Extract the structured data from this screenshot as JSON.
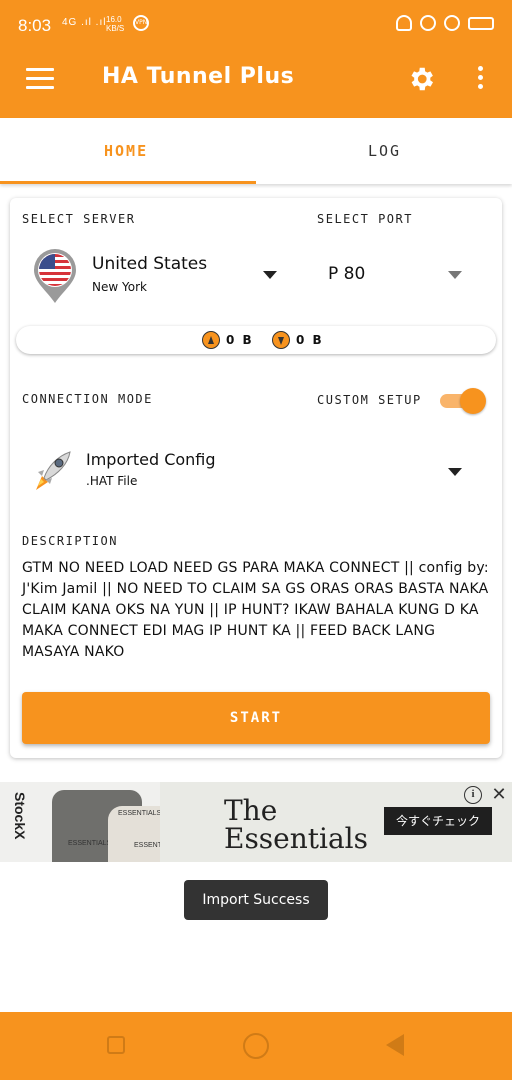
{
  "status_bar": {
    "time": "8:03",
    "signal_text": "4G .ıl .ıl",
    "speed_value": "16.0",
    "speed_unit": "KB/S",
    "vpn_label": "VPN",
    "icons": [
      "vpn-icon",
      "bell-off-icon",
      "location-icon",
      "check-icon",
      "battery-icon"
    ]
  },
  "app_bar": {
    "title": "HA Tunnel Plus",
    "icons": [
      "menu-icon",
      "gear-icon",
      "more-vert-icon"
    ]
  },
  "tabs": [
    {
      "label": "HOME",
      "active": true
    },
    {
      "label": "LOG",
      "active": false
    }
  ],
  "server": {
    "section_label": "SELECT SERVER",
    "country": "United States",
    "city": "New York",
    "flag_icon": "us-flag-pin-icon"
  },
  "port": {
    "section_label": "SELECT PORT",
    "value": "P 80"
  },
  "traffic": {
    "upload": "0 B",
    "download": "0 B"
  },
  "connection": {
    "section_label": "CONNECTION MODE",
    "custom_setup_label": "CUSTOM SETUP",
    "custom_setup_enabled": true,
    "mode_name": "Imported Config",
    "mode_file": ".HAT File",
    "mode_icon": "rocket-icon"
  },
  "description": {
    "section_label": "DESCRIPTION",
    "text": "GTM NO NEED LOAD NEED GS PARA MAKA CONNECT || config by: J'Kim Jamil || NO NEED TO CLAIM SA GS ORAS ORAS BASTA NAKA CLAIM KANA OKS NA YUN || IP HUNT? IKAW BAHALA KUNG D KA MAKA CONNECT EDI MAG IP HUNT KA || FEED BACK LANG MASAYA NAKO"
  },
  "start_button": {
    "label": "START"
  },
  "ad": {
    "brand": "StockX",
    "headline_line1": "The",
    "headline_line2": "Essentials",
    "cta": "今すぐチェック",
    "tee_label_1": "ESSENTIALS",
    "tee_label_2": "ESSENTIALS",
    "tee_label_3": "ESSENTIALS",
    "info_glyph": "i",
    "close_glyph": "✕"
  },
  "toast": {
    "text": "Import Success"
  },
  "colors": {
    "accent": "#f7931e",
    "toast_bg": "#333333"
  }
}
